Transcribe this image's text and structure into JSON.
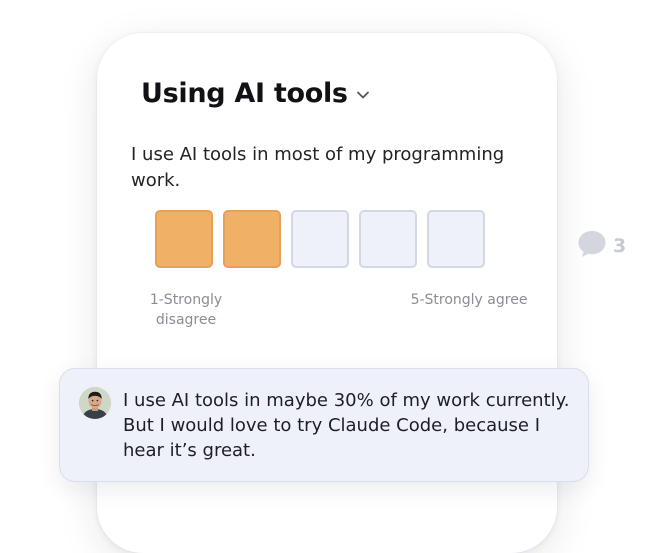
{
  "survey": {
    "title": "Using AI tools",
    "question": "I use AI tools in most of my programming work.",
    "scale": {
      "selected_value": 2,
      "max": 5,
      "low_label": "1-Strongly disagree",
      "high_label": "5-Strongly agree"
    }
  },
  "comments": {
    "count": "3"
  },
  "response": {
    "text": "I use AI tools in maybe 30% of my work currently. But I would love to try Claude Code, because I hear it’s great."
  },
  "colors": {
    "selected_fill": "#f0b066",
    "unselected_fill": "#eef1f8",
    "response_bg": "#eef1f9",
    "muted_text": "#8a8d96"
  },
  "icons": {
    "title_dropdown": "chevron-down-icon",
    "comments": "speech-bubble-icon",
    "avatar": "user-avatar"
  }
}
